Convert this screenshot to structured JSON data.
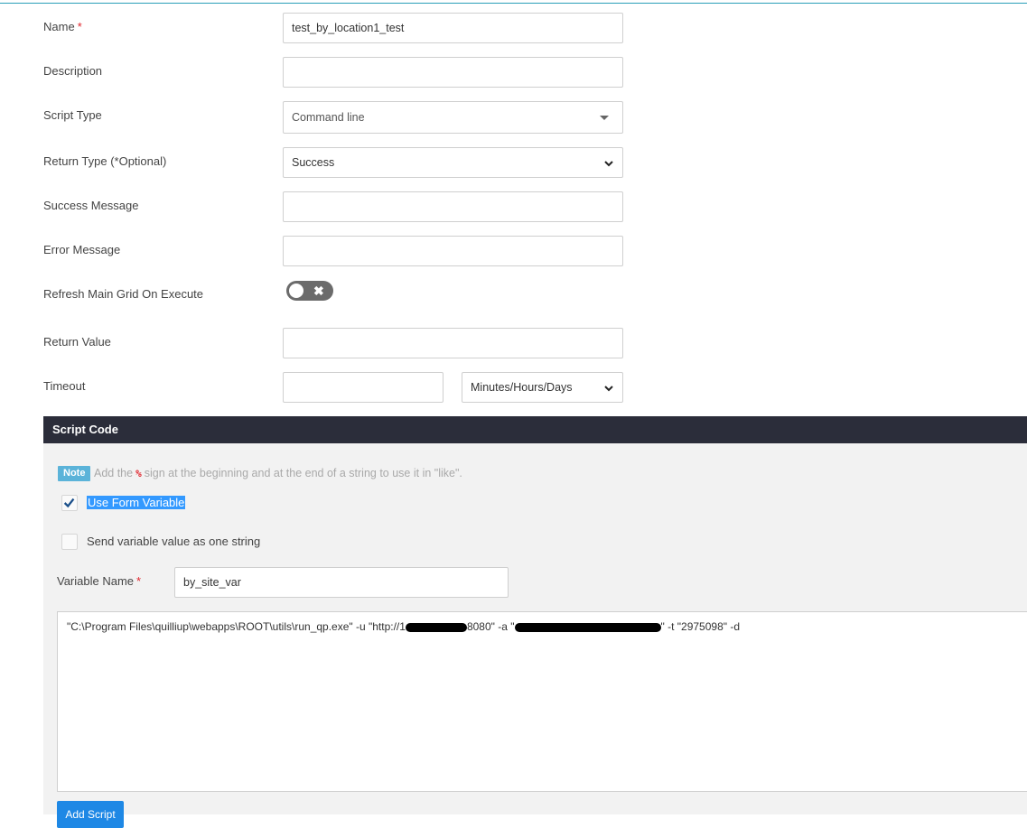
{
  "form": {
    "name": {
      "label": "Name",
      "required": "*",
      "value": "test_by_location1_test"
    },
    "description": {
      "label": "Description",
      "value": ""
    },
    "script_type": {
      "label": "Script Type",
      "value": "Command line"
    },
    "return_type": {
      "label": "Return Type (*Optional)",
      "value": "Success"
    },
    "success_message": {
      "label": "Success Message",
      "value": ""
    },
    "error_message": {
      "label": "Error Message",
      "value": ""
    },
    "refresh_main_grid": {
      "label": "Refresh Main Grid On Execute",
      "enabled": false,
      "off_glyph": "✖"
    },
    "return_value": {
      "label": "Return Value",
      "value": ""
    },
    "timeout": {
      "label": "Timeout",
      "value": "",
      "unit": "Minutes/Hours/Days"
    }
  },
  "script_code": {
    "title": "Script Code",
    "note_badge": "Note",
    "note_before": "Add the",
    "note_symbol": "%",
    "note_after": "sign at the beginning and at the end of a string to use it in \"like\".",
    "use_form_variable": {
      "label": "Use Form Variable",
      "checked": true
    },
    "send_as_one_string": {
      "label": "Send variable value as one string",
      "checked": false
    },
    "variable_name": {
      "label": "Variable Name",
      "required": "*",
      "value": "by_site_var"
    },
    "code_part1": "\"C:\\Program Files\\quilliup\\webapps\\ROOT\\utils\\run_qp.exe\" -u  \"http://1",
    "code_part2": "8080\" -a \"",
    "code_part3": "\" -t \"2975098\" -d",
    "add_button": "Add Script"
  },
  "colors": {
    "accent": "#1e88e5",
    "section_header": "#2b2d3a",
    "note_badge": "#5bb3d9",
    "required": "#e0262d",
    "selection": "#3399ff"
  }
}
